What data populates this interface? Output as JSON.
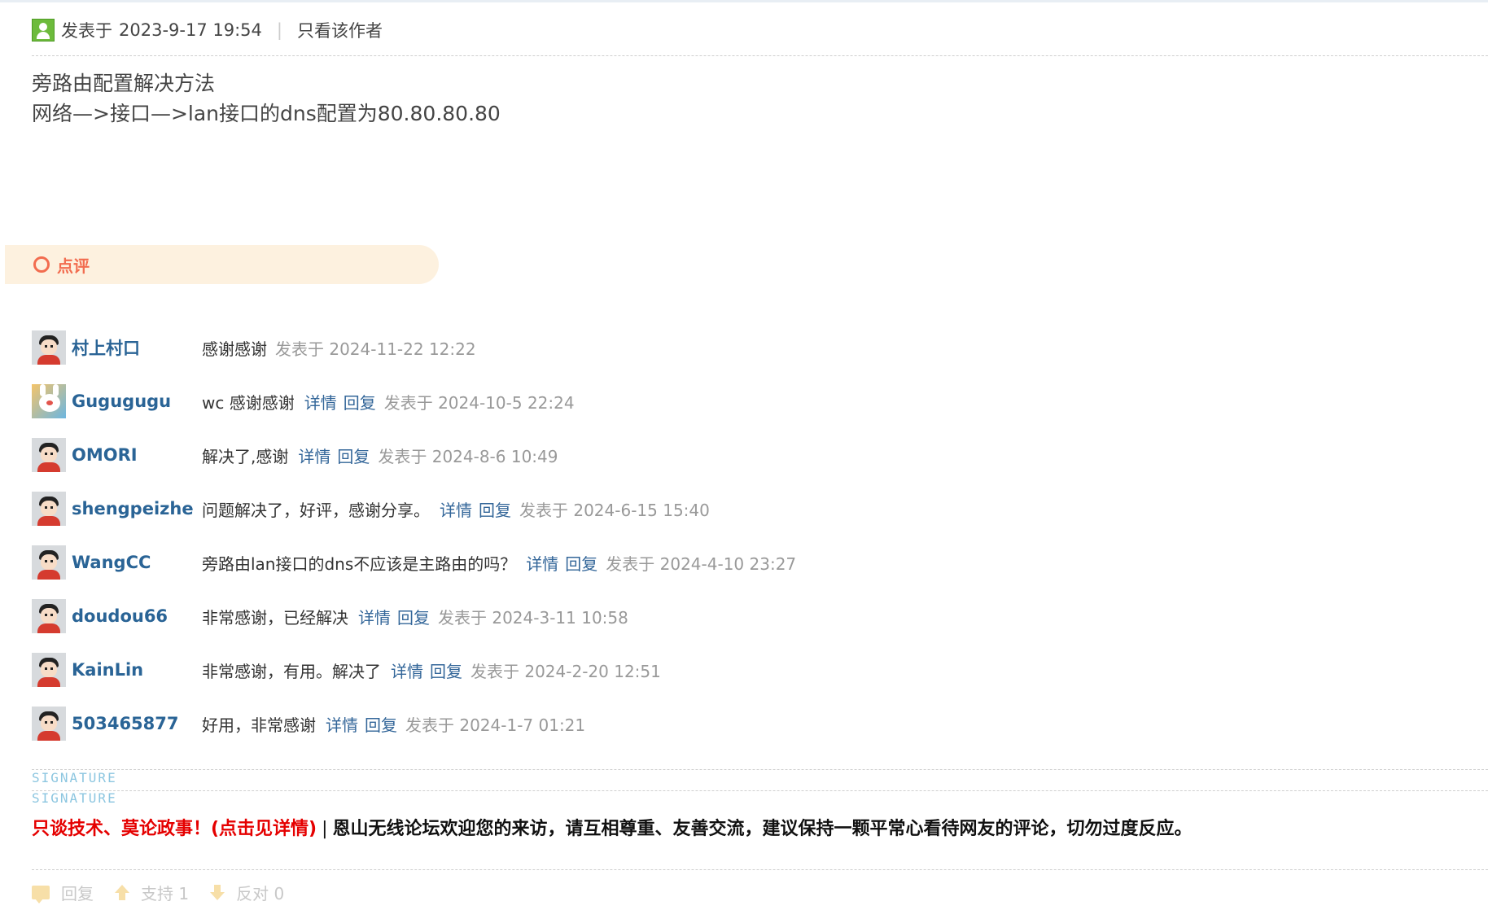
{
  "post": {
    "posted_label": "发表于",
    "posted_time": "2023-9-17 19:54",
    "separator": "|",
    "only_author": "只看该作者",
    "content_line1": "旁路由配置解决方法",
    "content_line2": "网络—>接口—>lan接口的dns配置为80.80.80.80"
  },
  "dianping": {
    "label": "点评"
  },
  "comments": [
    {
      "user": "村上村口",
      "avatar": "default-avatar",
      "text": "感谢感谢",
      "detail": "",
      "reply": "",
      "time": "发表于 2024-11-22 12:22"
    },
    {
      "user": "Gugugugu",
      "avatar": "rabbit-avatar",
      "text": "wc 感谢感谢",
      "detail": "详情",
      "reply": "回复",
      "time": "发表于 2024-10-5 22:24"
    },
    {
      "user": "OMORI",
      "avatar": "default-avatar",
      "text": "解决了,感谢",
      "detail": "详情",
      "reply": "回复",
      "time": "发表于 2024-8-6 10:49"
    },
    {
      "user": "shengpeizhe",
      "avatar": "default-avatar",
      "text": "问题解决了，好评，感谢分享。",
      "detail": "详情",
      "reply": "回复",
      "time": "发表于 2024-6-15 15:40"
    },
    {
      "user": "WangCC",
      "avatar": "default-avatar",
      "text": "旁路由lan接口的dns不应该是主路由的吗？",
      "detail": "详情",
      "reply": "回复",
      "time": "发表于 2024-4-10 23:27"
    },
    {
      "user": "doudou66",
      "avatar": "default-avatar",
      "text": "非常感谢，已经解决",
      "detail": "详情",
      "reply": "回复",
      "time": "发表于 2024-3-11 10:58"
    },
    {
      "user": "KainLin",
      "avatar": "default-avatar",
      "text": "非常感谢，有用。解决了",
      "detail": "详情",
      "reply": "回复",
      "time": "发表于 2024-2-20 12:51"
    },
    {
      "user": "503465877",
      "avatar": "default-avatar",
      "text": "好用，非常感谢",
      "detail": "详情",
      "reply": "回复",
      "time": "发表于 2024-1-7 01:21"
    }
  ],
  "signature": {
    "label1": "SIGNATURE",
    "label2": "SIGNATURE"
  },
  "notice": {
    "red_text": "只谈技术、莫论政事！(点击见详情)",
    "separator": "|",
    "text": "恩山无线论坛欢迎您的来访，请互相尊重、友善交流，建议保持一颗平常心看待网友的评论，切勿过度反应。"
  },
  "actions": {
    "reply": "回复",
    "support": "支持 1",
    "oppose": "反对 0"
  },
  "colors": {
    "username": "#2a6496",
    "link": "#336699",
    "accent": "#f26c4f",
    "notice_red": "#e50000"
  }
}
